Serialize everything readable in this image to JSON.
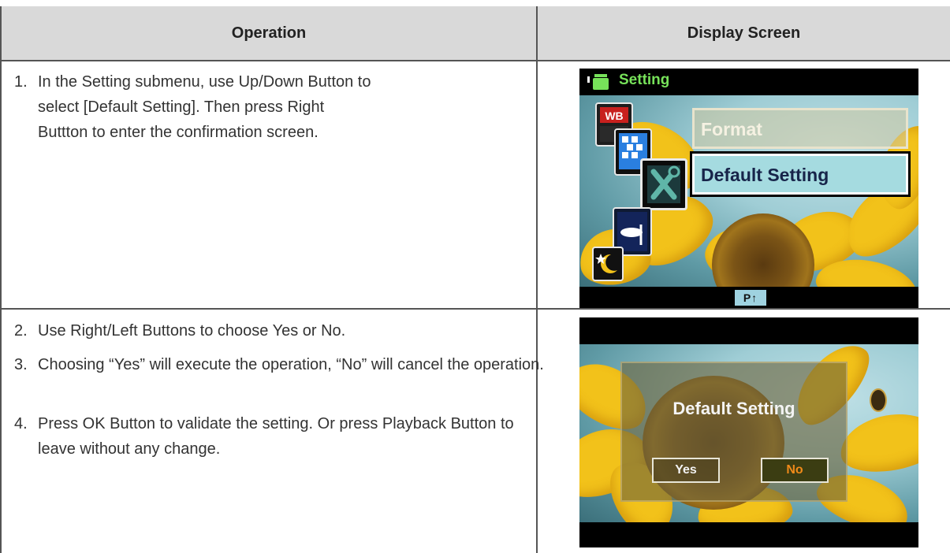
{
  "table": {
    "header_operation": "Operation",
    "header_display": "Display Screen"
  },
  "steps": [
    {
      "num": "1.",
      "text": "In the Setting submenu, use Up/Down Button to select [Default Setting]. Then press Right Buttton to enter the confirmation screen."
    },
    {
      "num": "2.",
      "text": "Use Right/Left Buttons to choose Yes or No."
    },
    {
      "num": "3.",
      "text": "Choosing “Yes” will execute the operation, “No” will cancel the operation."
    },
    {
      "num": "4.",
      "text": "Press OK Button to validate the setting. Or press Playback Button to leave without any change."
    }
  ],
  "screen1": {
    "title": "Setting",
    "menu_items": [
      "Format",
      "Default Setting"
    ],
    "selected_item": "Default Setting",
    "bottom_badge": "P↑",
    "wb_label": "WB",
    "colors": {
      "title": "#77e25a",
      "selected_bg": "#a5dbe0"
    }
  },
  "screen2": {
    "dialog_title": "Default Setting",
    "yes_label": "Yes",
    "no_label": "No",
    "colors": {
      "no_text": "#f08a19"
    }
  }
}
